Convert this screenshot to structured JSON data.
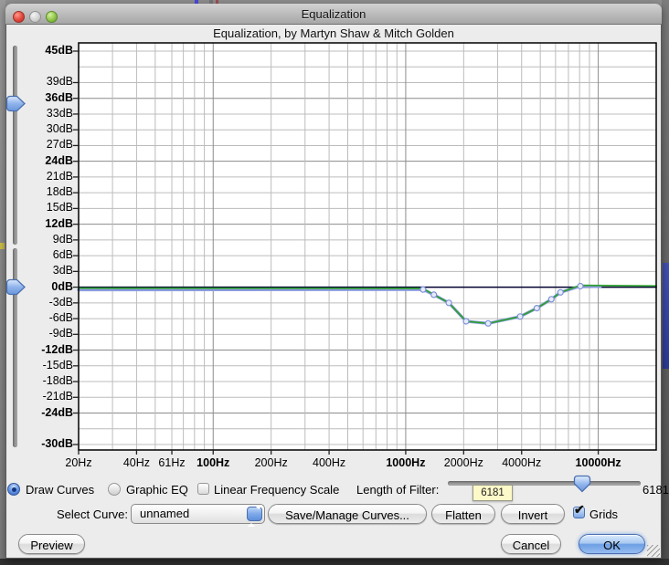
{
  "window": {
    "title": "Equalization",
    "subtitle": "Equalization, by Martyn Shaw & Mitch Golden"
  },
  "chart_data": {
    "type": "line",
    "title": "Equalization, by Martyn Shaw & Mitch Golden",
    "grid": true,
    "x_axis": {
      "scale": "log",
      "unit": "Hz",
      "min": 20,
      "max": 20000,
      "ticks": [
        {
          "label": "20Hz",
          "freq": 20,
          "bold": false
        },
        {
          "label": "40Hz",
          "freq": 40,
          "bold": false
        },
        {
          "label": "61Hz",
          "freq": 61,
          "bold": false
        },
        {
          "label": "100Hz",
          "freq": 100,
          "bold": true
        },
        {
          "label": "200Hz",
          "freq": 200,
          "bold": false
        },
        {
          "label": "400Hz",
          "freq": 400,
          "bold": false
        },
        {
          "label": "1000Hz",
          "freq": 1000,
          "bold": true
        },
        {
          "label": "2000Hz",
          "freq": 2000,
          "bold": false
        },
        {
          "label": "4000Hz",
          "freq": 4000,
          "bold": false
        },
        {
          "label": "10000Hz",
          "freq": 10000,
          "bold": true
        }
      ],
      "gridline_freqs": [
        30,
        40,
        50,
        61,
        70,
        80,
        90,
        100,
        200,
        300,
        400,
        500,
        600,
        700,
        800,
        900,
        1000,
        2000,
        3000,
        4000,
        5000,
        6000,
        7000,
        8000,
        9000,
        10000
      ]
    },
    "y_axis": {
      "unit": "dB",
      "min": -30,
      "max": 45,
      "step": 3,
      "ticks": [
        {
          "label": "45dB",
          "db": 45,
          "bold": true
        },
        {
          "label": "39dB",
          "db": 39,
          "bold": false
        },
        {
          "label": "36dB",
          "db": 36,
          "bold": true
        },
        {
          "label": "33dB",
          "db": 33,
          "bold": false
        },
        {
          "label": "30dB",
          "db": 30,
          "bold": false
        },
        {
          "label": "27dB",
          "db": 27,
          "bold": false
        },
        {
          "label": "24dB",
          "db": 24,
          "bold": true
        },
        {
          "label": "21dB",
          "db": 21,
          "bold": false
        },
        {
          "label": "18dB",
          "db": 18,
          "bold": false
        },
        {
          "label": "15dB",
          "db": 15,
          "bold": false
        },
        {
          "label": "12dB",
          "db": 12,
          "bold": true
        },
        {
          "label": "9dB",
          "db": 9,
          "bold": false
        },
        {
          "label": "6dB",
          "db": 6,
          "bold": false
        },
        {
          "label": "3dB",
          "db": 3,
          "bold": false
        },
        {
          "label": "0dB",
          "db": 0,
          "bold": true
        },
        {
          "label": "-3dB",
          "db": -3,
          "bold": false
        },
        {
          "label": "-6dB",
          "db": -6,
          "bold": false
        },
        {
          "label": "-9dB",
          "db": -9,
          "bold": false
        },
        {
          "label": "-12dB",
          "db": -12,
          "bold": true
        },
        {
          "label": "-15dB",
          "db": -15,
          "bold": false
        },
        {
          "label": "-18dB",
          "db": -18,
          "bold": false
        },
        {
          "label": "-21dB",
          "db": -21,
          "bold": false
        },
        {
          "label": "-24dB",
          "db": -24,
          "bold": true
        },
        {
          "label": "-30dB",
          "db": -30,
          "bold": true
        }
      ]
    },
    "series": [
      {
        "name": "zero-db-line",
        "color": "#000030",
        "width": 1.5,
        "points": [
          [
            20,
            0
          ],
          [
            20000,
            0
          ]
        ]
      },
      {
        "name": "drawn-eq-curve",
        "color": "#8b9bdf",
        "width": 3.2,
        "points": [
          [
            20,
            -0.5
          ],
          [
            1230,
            -0.45
          ],
          [
            1400,
            -1.45
          ],
          [
            1675,
            -3.0
          ],
          [
            2060,
            -6.5
          ],
          [
            2680,
            -6.9
          ],
          [
            3930,
            -5.6
          ],
          [
            4800,
            -4.0
          ],
          [
            5710,
            -2.3
          ],
          [
            6370,
            -1.0
          ],
          [
            8070,
            0.2
          ],
          [
            10250,
            0.1
          ]
        ]
      },
      {
        "name": "filter-response-curve",
        "color": "#2ea02e",
        "width": 1.7,
        "points": [
          [
            20,
            -0.2
          ],
          [
            1230,
            -0.25
          ],
          [
            1400,
            -1.45
          ],
          [
            1675,
            -3.0
          ],
          [
            2060,
            -6.5
          ],
          [
            2680,
            -6.9
          ],
          [
            3930,
            -5.6
          ],
          [
            4800,
            -4.0
          ],
          [
            5710,
            -2.3
          ],
          [
            6370,
            -1.0
          ],
          [
            8070,
            0.35
          ],
          [
            20000,
            0.25
          ]
        ]
      }
    ],
    "control_points": [
      [
        1230,
        -0.45
      ],
      [
        1400,
        -1.45
      ],
      [
        1675,
        -3.0
      ],
      [
        2060,
        -6.5
      ],
      [
        2680,
        -6.9
      ],
      [
        3930,
        -5.6
      ],
      [
        4800,
        -4.0
      ],
      [
        5710,
        -2.3
      ],
      [
        6370,
        -1.0
      ],
      [
        8070,
        0.2
      ]
    ],
    "db_range_sliders": {
      "upper_value_db": 35,
      "lower_value_db": 0
    }
  },
  "controls": {
    "draw_curves": "Draw Curves",
    "graphic_eq": "Graphic EQ",
    "linear_freq": "Linear Frequency Scale",
    "length_of_filter": "Length of Filter:",
    "filter_length_value": "6181",
    "filter_length_tooltip": "6181",
    "select_curve": "Select Curve:",
    "curve_name": "unnamed",
    "save_manage": "Save/Manage Curves...",
    "flatten": "Flatten",
    "invert": "Invert",
    "grids": "Grids",
    "preview": "Preview",
    "cancel": "Cancel",
    "ok": "OK"
  },
  "colors": {
    "curve_blue": "#8b9bdf",
    "curve_green": "#2ea02e",
    "zero_line": "#000030",
    "grid": "#bcbcbc",
    "grid_bold": "#8c8c8c",
    "tooltip_bg": "#fdf9c9",
    "point_fill": "#e7ecf9",
    "point_stroke": "#7e90d8"
  }
}
